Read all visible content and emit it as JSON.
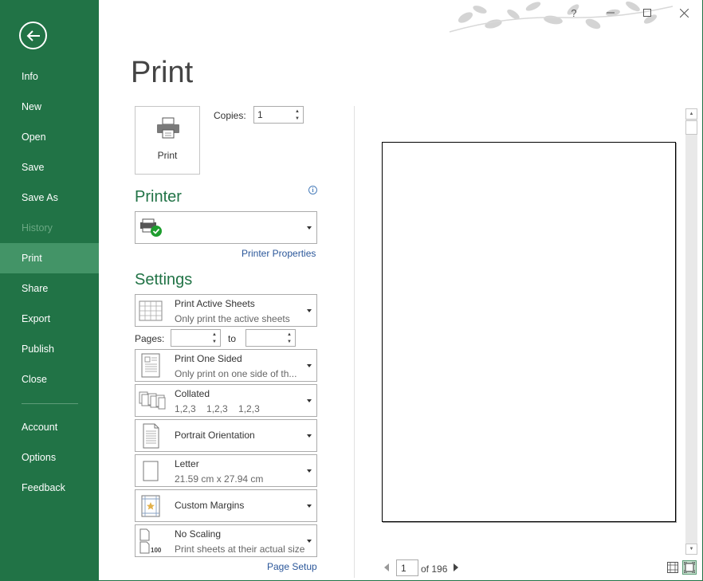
{
  "sidebar": {
    "items": [
      {
        "label": "Info"
      },
      {
        "label": "New"
      },
      {
        "label": "Open"
      },
      {
        "label": "Save"
      },
      {
        "label": "Save As"
      },
      {
        "label": "History"
      },
      {
        "label": "Print"
      },
      {
        "label": "Share"
      },
      {
        "label": "Export"
      },
      {
        "label": "Publish"
      },
      {
        "label": "Close"
      },
      {
        "label": "Account"
      },
      {
        "label": "Options"
      },
      {
        "label": "Feedback"
      }
    ]
  },
  "window": {
    "help_label": "?"
  },
  "main": {
    "title": "Print",
    "print_button_label": "Print",
    "copies_label": "Copies:",
    "copies_value": "1",
    "printer_section_title": "Printer",
    "printer_properties_link": "Printer Properties",
    "settings_section_title": "Settings",
    "settings": [
      {
        "title": "Print Active Sheets",
        "subtitle": "Only print the active sheets"
      },
      {
        "title": "Print One Sided",
        "subtitle": "Only print on one side of th..."
      },
      {
        "title": "Collated",
        "subtitle": "1,2,3    1,2,3    1,2,3"
      },
      {
        "title": "Portrait Orientation",
        "subtitle": ""
      },
      {
        "title": "Letter",
        "subtitle": "21.59 cm x 27.94 cm"
      },
      {
        "title": "Custom Margins",
        "subtitle": ""
      },
      {
        "title": "No Scaling",
        "subtitle": "Print sheets at their actual size"
      }
    ],
    "pages_label": "Pages:",
    "pages_from": "",
    "pages_to_label": "to",
    "pages_to": "",
    "page_setup_link": "Page Setup"
  },
  "preview": {
    "current_page": "1",
    "of_label": "of 196"
  },
  "colors": {
    "accent": "#217346",
    "active_nav": "#439467",
    "link": "#2b579a"
  }
}
